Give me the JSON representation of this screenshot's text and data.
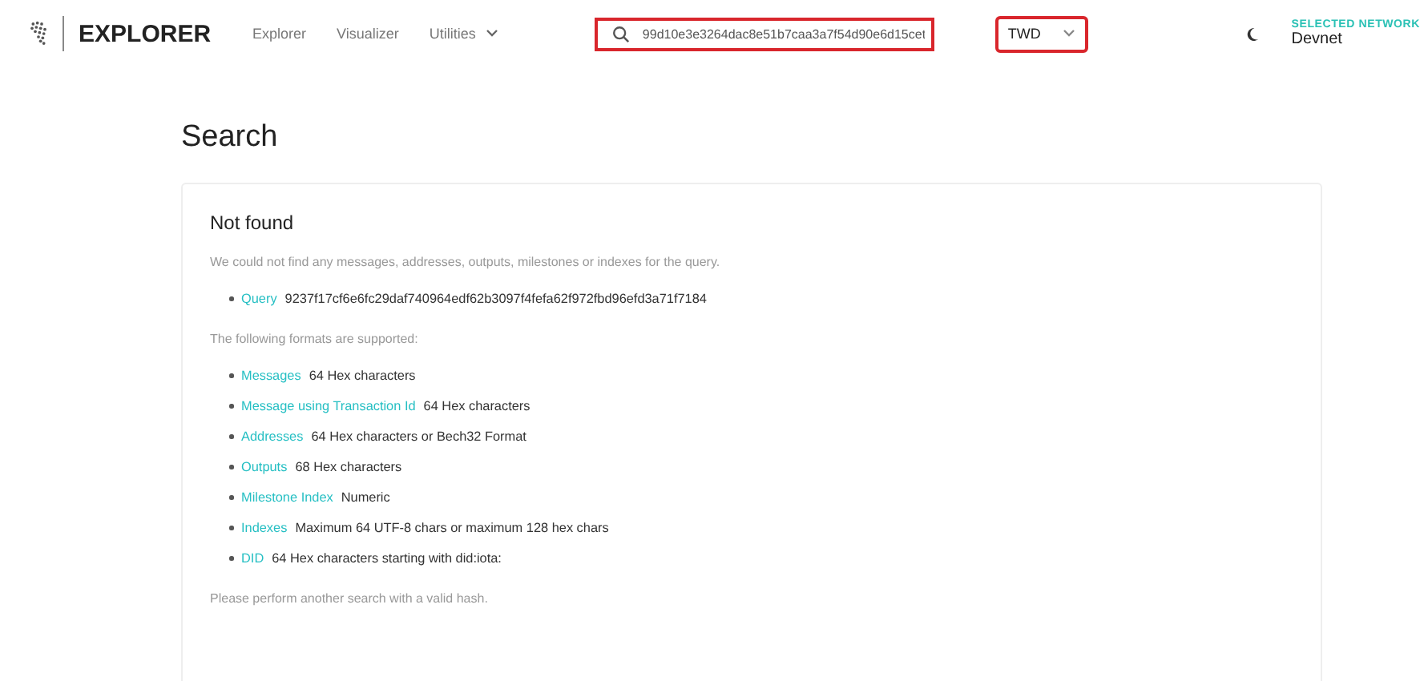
{
  "header": {
    "brand": "EXPLORER",
    "nav": [
      {
        "label": "Explorer",
        "kind": "link"
      },
      {
        "label": "Visualizer",
        "kind": "link"
      },
      {
        "label": "Utilities",
        "kind": "dropdown"
      }
    ],
    "search": {
      "value": "99d10e3e3264dac8e51b7caa3a7f54d90e6d15cet",
      "highlighted": true
    },
    "currency": {
      "value": "TWD",
      "highlighted": true
    },
    "network": {
      "label": "SELECTED NETWORK",
      "value": "Devnet"
    }
  },
  "page_title": "Search",
  "card": {
    "title": "Not found",
    "message": "We could not find any messages, addresses, outputs, milestones or indexes for the query.",
    "query": {
      "label": "Query",
      "value": "9237f17cf6e6fc29daf740964edf62b3097f4fefa62f972fbd96efd3a71f7184"
    },
    "formats_intro": "The following formats are supported:",
    "formats": [
      {
        "label": "Messages",
        "description": "64 Hex characters"
      },
      {
        "label": "Message using Transaction Id",
        "description": "64 Hex characters"
      },
      {
        "label": "Addresses",
        "description": "64 Hex characters or Bech32 Format"
      },
      {
        "label": "Outputs",
        "description": "68 Hex characters"
      },
      {
        "label": "Milestone Index",
        "description": "Numeric"
      },
      {
        "label": "Indexes",
        "description": "Maximum 64 UTF-8 chars or maximum 128 hex chars"
      },
      {
        "label": "DID",
        "description": "64 Hex characters starting with did:iota:"
      }
    ],
    "footer": "Please perform another search with a valid hash."
  }
}
